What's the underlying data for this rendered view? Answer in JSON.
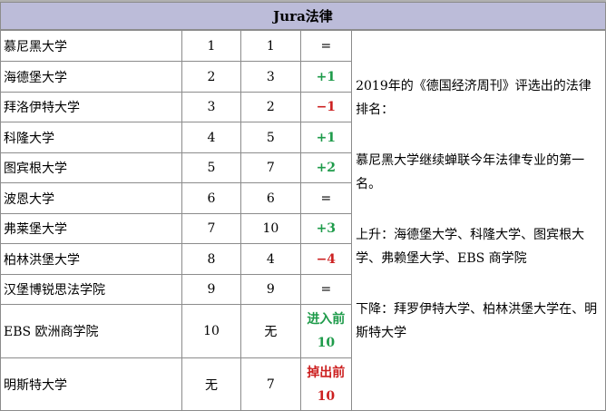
{
  "header": {
    "title": "Jura法律"
  },
  "rows": [
    {
      "name": "慕尼黑大学",
      "rank2019": "1",
      "rank2018": "1",
      "change": "="
    },
    {
      "name": "海德堡大学",
      "rank2019": "2",
      "rank2018": "3",
      "change": "+1"
    },
    {
      "name": "拜洛伊特大学",
      "rank2019": "3",
      "rank2018": "2",
      "change": "−1"
    },
    {
      "name": "科隆大学",
      "rank2019": "4",
      "rank2018": "5",
      "change": "+1"
    },
    {
      "name": "图宾根大学",
      "rank2019": "5",
      "rank2018": "7",
      "change": "+2"
    },
    {
      "name": "波恩大学",
      "rank2019": "6",
      "rank2018": "6",
      "change": "="
    },
    {
      "name": "弗莱堡大学",
      "rank2019": "7",
      "rank2018": "10",
      "change": "+3"
    },
    {
      "name": "柏林洪堡大学",
      "rank2019": "8",
      "rank2018": "4",
      "change": "−4"
    },
    {
      "name": "汉堡博锐思法学院",
      "rank2019": "9",
      "rank2018": "9",
      "change": "="
    },
    {
      "name": "EBS 欧洲商学院",
      "rank2019": "10",
      "rank2018": "无",
      "change": "进入前10"
    },
    {
      "name": "明斯特大学",
      "rank2019": "无",
      "rank2018": "7",
      "change": "掉出前10"
    }
  ],
  "notes": {
    "intro": "2019年的《德国经济周刊》评选出的法律排名：",
    "first": "慕尼黑大学继续蝉联今年法律专业的第一名。",
    "rise": "上升：海德堡大学、科隆大学、图宾根大学、弗赖堡大学、EBS 商学院",
    "fall": "下降：拜罗伊特大学、柏林洪堡大学在、明斯特大学"
  },
  "colors": {
    "header_bg": "#bcbcd9",
    "up": "#1e9b4a",
    "down": "#cc1f1f",
    "border": "#8c8c8c"
  }
}
